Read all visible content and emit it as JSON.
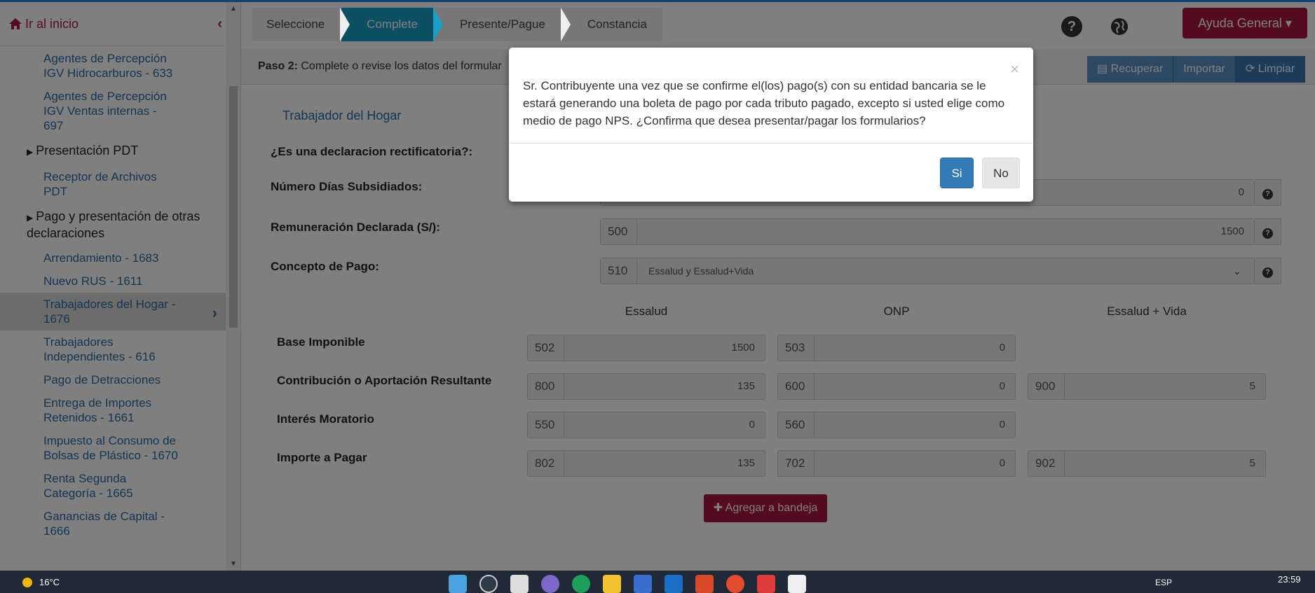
{
  "sidebar": {
    "home_label": "Ir al inicio",
    "items": [
      {
        "label": "Agentes de Percepción IGV Hidrocarburos - 633",
        "type": "link"
      },
      {
        "label": "Agentes de Percepción IGV Ventas internas - 697",
        "type": "link"
      },
      {
        "label": "Presentación PDT",
        "type": "section"
      },
      {
        "label": "Receptor de Archivos PDT",
        "type": "link"
      },
      {
        "label": "Pago y presentación de otras declaraciones",
        "type": "section"
      },
      {
        "label": "Arrendamiento - 1683",
        "type": "link"
      },
      {
        "label": "Nuevo RUS - 1611",
        "type": "link"
      },
      {
        "label": "Trabajadores del Hogar - 1676",
        "type": "link",
        "active": true
      },
      {
        "label": "Trabajadores Independientes - 616",
        "type": "link"
      },
      {
        "label": "Pago de Detracciones",
        "type": "link"
      },
      {
        "label": "Entrega de Importes Retenidos - 1661",
        "type": "link"
      },
      {
        "label": "Impuesto al Consumo de Bolsas de Plástico - 1670",
        "type": "link"
      },
      {
        "label": "Renta Segunda Categoría - 1665",
        "type": "link"
      },
      {
        "label": "Ganancias de Capital - 1666",
        "type": "link"
      }
    ]
  },
  "wizard": {
    "steps": [
      "Seleccione",
      "Complete",
      "Presente/Pague",
      "Constancia"
    ],
    "active_step": "Complete"
  },
  "header": {
    "help_button": "Ayuda General ▾"
  },
  "paso": {
    "prefix": "Paso 2:",
    "text": "Complete o revise los datos del formular",
    "recuperar": "Recuperar",
    "importar": "Importar",
    "limpiar": "Limpiar"
  },
  "form": {
    "section_title": "Trabajador del Hogar",
    "rectificatoria_label": "¿Es una declaracion rectificatoria?:",
    "dias_label": "Número Días Subsidiados:",
    "dias_value": "0",
    "remun_label": "Remuneración Declarada (S/):",
    "remun_code": "500",
    "remun_value": "1500",
    "concepto_label": "Concepto de Pago:",
    "concepto_code": "510",
    "concepto_value": "Essalud y Essalud+Vida",
    "columns": [
      "Essalud",
      "ONP",
      "Essalud + Vida"
    ],
    "rows": [
      {
        "label": "Base Imponible",
        "cells": [
          {
            "code": "502",
            "value": "1500"
          },
          {
            "code": "503",
            "value": "0"
          }
        ]
      },
      {
        "label": "Contribución o Aportación Resultante",
        "cells": [
          {
            "code": "800",
            "value": "135"
          },
          {
            "code": "600",
            "value": "0"
          },
          {
            "code": "900",
            "value": "5"
          }
        ]
      },
      {
        "label": "Interés Moratorio",
        "cells": [
          {
            "code": "550",
            "value": "0"
          },
          {
            "code": "560",
            "value": "0"
          }
        ]
      },
      {
        "label": "Importe a Pagar",
        "cells": [
          {
            "code": "802",
            "value": "135"
          },
          {
            "code": "702",
            "value": "0"
          },
          {
            "code": "902",
            "value": "5"
          }
        ]
      }
    ],
    "agregar_label": "Agregar a bandeja"
  },
  "modal": {
    "close": "×",
    "message": "Sr. Contribuyente una vez que se confirme el(los) pago(s) con su entidad bancaria se le estará generando una boleta de pago por cada tributo pagado, excepto si usted elige como medio de pago NPS. ¿Confirma que desea presentar/pagar los formularios?",
    "yes": "Si",
    "no": "No"
  },
  "taskbar": {
    "temperature": "16°C",
    "language": "ESP",
    "time": "23:59"
  }
}
